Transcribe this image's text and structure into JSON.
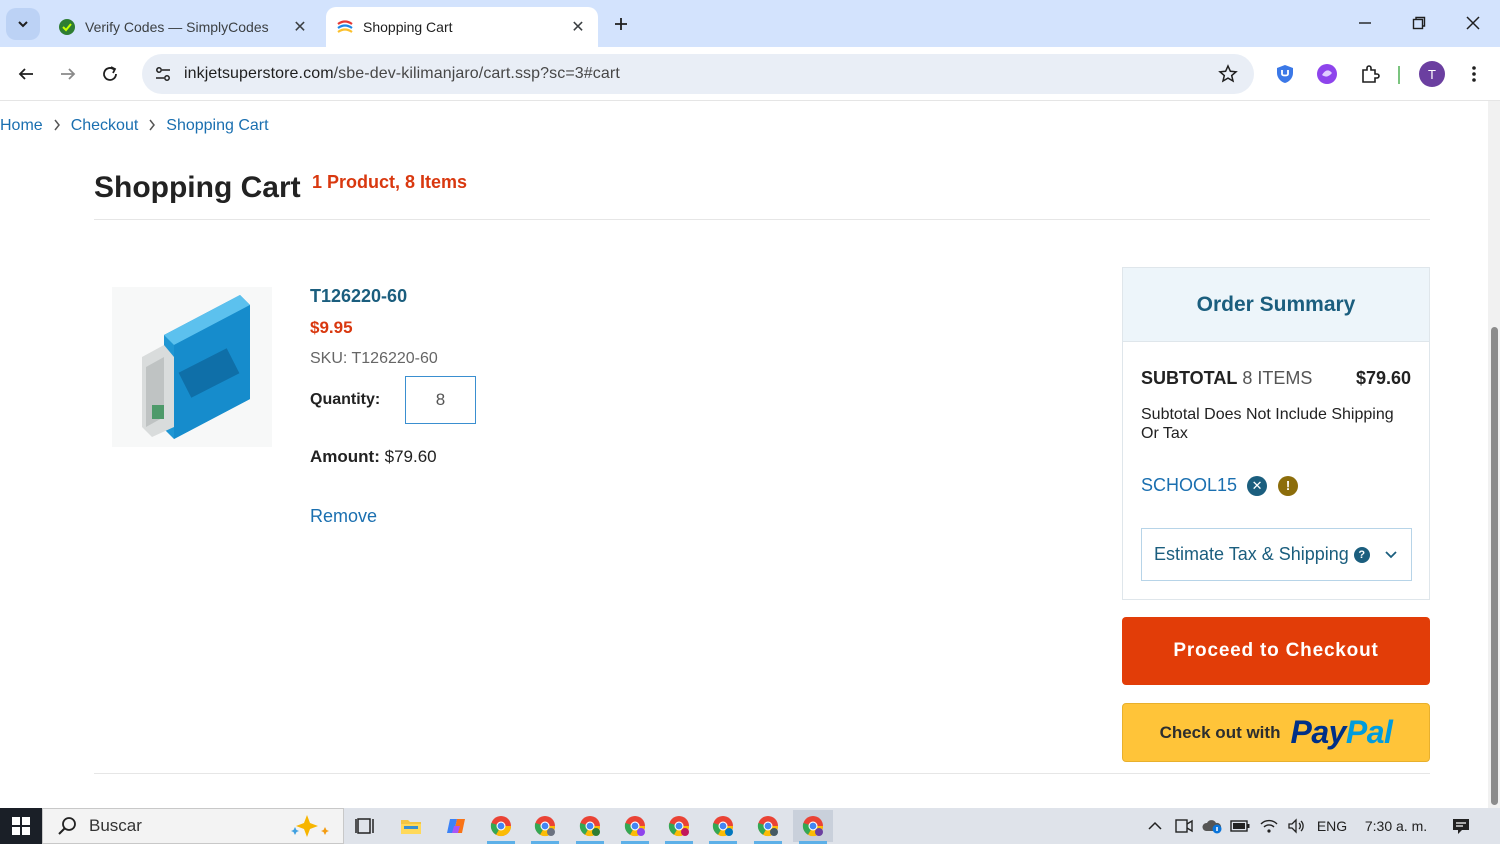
{
  "browser": {
    "tabs": [
      {
        "title": "Verify Codes — SimplyCodes",
        "active": false
      },
      {
        "title": "Shopping Cart",
        "active": true
      }
    ],
    "url_host": "inkjetsuperstore.com",
    "url_path": "/sbe-dev-kilimanjaro/cart.ssp?sc=3#cart",
    "profile_initial": "T"
  },
  "breadcrumb": {
    "home": "Home",
    "checkout": "Checkout",
    "current": "Shopping Cart"
  },
  "cart": {
    "title": "Shopping Cart",
    "count": "1 Product, 8 Items"
  },
  "item": {
    "name": "T126220-60",
    "price": "$9.95",
    "sku": "SKU: T126220-60",
    "quantity_label": "Quantity:",
    "quantity": "8",
    "amount_label": "Amount:",
    "amount": "$79.60",
    "remove": "Remove"
  },
  "summary": {
    "title": "Order Summary",
    "subtotal_label": "SUBTOTAL",
    "subtotal_items": "8 ITEMS",
    "subtotal_value": "$79.60",
    "note": "Subtotal Does Not Include Shipping Or Tax",
    "coupon": "SCHOOL15",
    "estimate": "Estimate Tax & Shipping"
  },
  "actions": {
    "checkout": "Proceed to Checkout",
    "paypal_prefix": "Check out with",
    "paypal_pay": "Pay",
    "paypal_pal": "Pal"
  },
  "taskbar": {
    "search": "Buscar",
    "lang": "ENG",
    "time": "7:30 a. m."
  },
  "colors": {
    "accent_red": "#e23d08",
    "link_blue": "#1a6fb0",
    "heading_teal": "#1b5e7e",
    "paypal_yellow": "#ffc439"
  }
}
